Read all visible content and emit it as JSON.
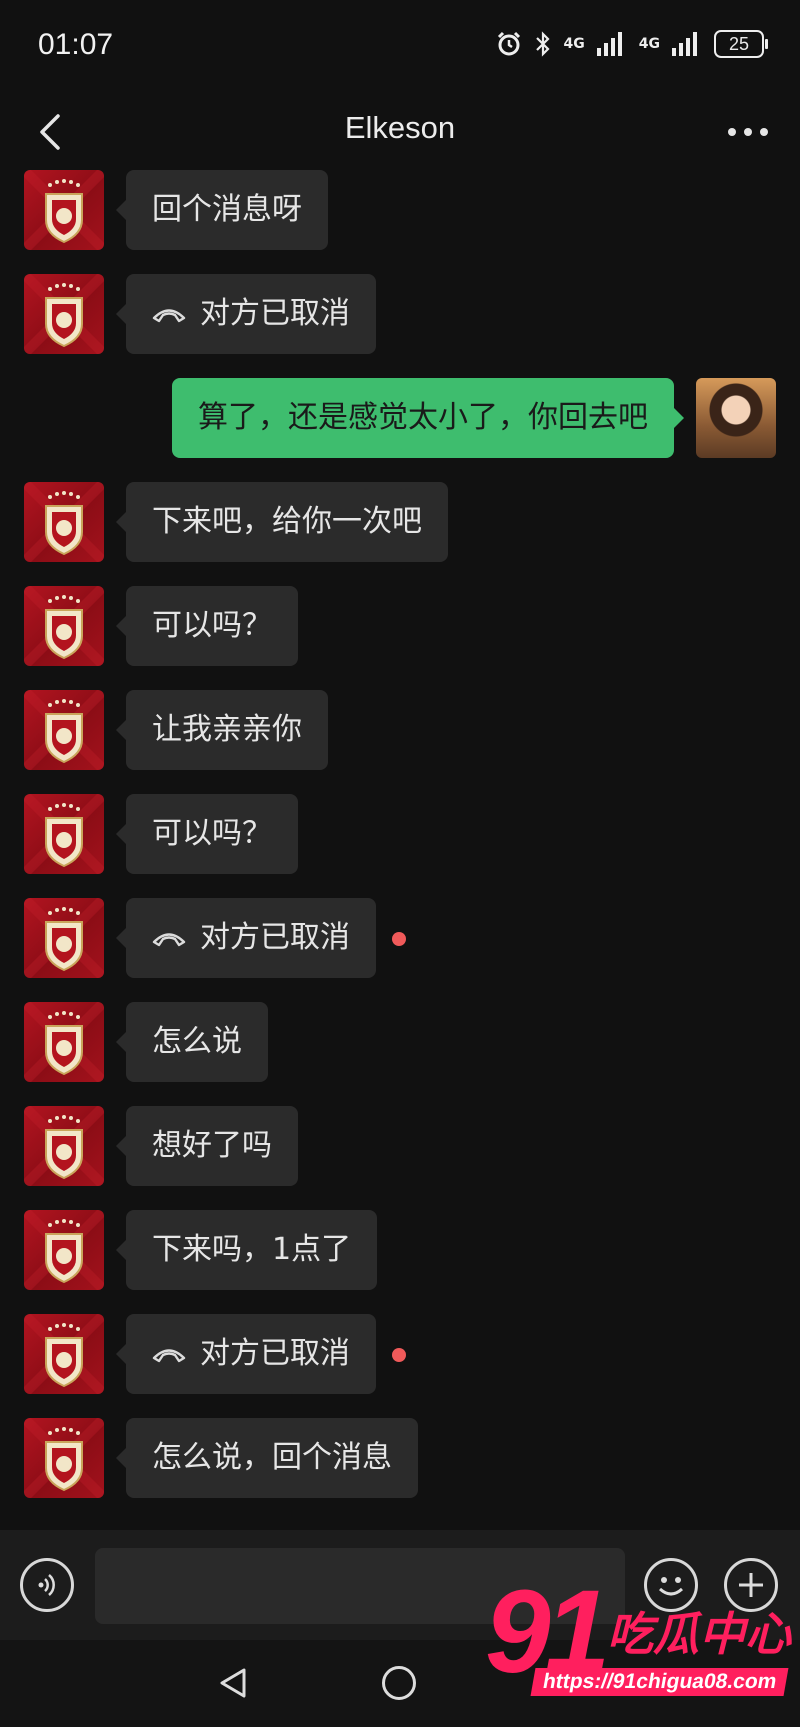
{
  "status_bar": {
    "time": "01:07",
    "network_1": "4G",
    "network_2": "4G",
    "battery": "25"
  },
  "header": {
    "title": "Elkeson"
  },
  "messages": [
    {
      "side": "left",
      "type": "text",
      "text": "回个消息呀"
    },
    {
      "side": "left",
      "type": "call",
      "text": "对方已取消",
      "unread": false
    },
    {
      "side": "right",
      "type": "text",
      "text": "算了，还是感觉太小了，你回去吧"
    },
    {
      "side": "left",
      "type": "text",
      "text": "下来吧，给你一次吧"
    },
    {
      "side": "left",
      "type": "text",
      "text": "可以吗？"
    },
    {
      "side": "left",
      "type": "text",
      "text": "让我亲亲你"
    },
    {
      "side": "left",
      "type": "text",
      "text": "可以吗？"
    },
    {
      "side": "left",
      "type": "call",
      "text": "对方已取消",
      "unread": true
    },
    {
      "side": "left",
      "type": "text",
      "text": "怎么说"
    },
    {
      "side": "left",
      "type": "text",
      "text": "想好了吗"
    },
    {
      "side": "left",
      "type": "text",
      "text": "下来吗，1点了"
    },
    {
      "side": "left",
      "type": "call",
      "text": "对方已取消",
      "unread": true
    },
    {
      "side": "left",
      "type": "text",
      "text": "怎么说，回个消息"
    }
  ],
  "input": {
    "placeholder": "",
    "value": ""
  },
  "watermark": {
    "brand_number": "91",
    "brand_text": "吃瓜中心",
    "url": "https://91chigua08.com"
  },
  "colors": {
    "background": "#111111",
    "bubble_incoming": "#2b2b2b",
    "bubble_outgoing": "#3ebd6e",
    "unread_dot": "#f05a5a",
    "watermark": "#ff1f5e"
  }
}
